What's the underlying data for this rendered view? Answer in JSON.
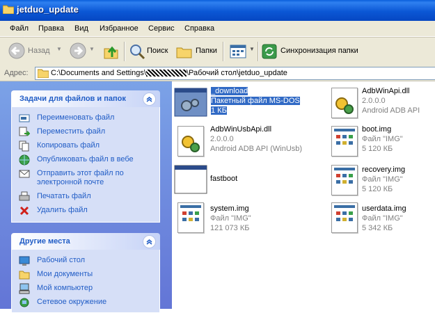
{
  "window": {
    "title": "jetduo_update"
  },
  "menu": [
    "Файл",
    "Правка",
    "Вид",
    "Избранное",
    "Сервис",
    "Справка"
  ],
  "toolbar": {
    "back": "Назад",
    "search": "Поиск",
    "folders": "Папки",
    "sync": "Синхронизация папки"
  },
  "address": {
    "label": "Адрес:",
    "path_start": "C:\\Documents and Settings\\",
    "path_end": "\\Рабочий стол\\jetduo_update"
  },
  "tasks_panel": {
    "title": "Задачи для файлов и папок",
    "items": [
      "Переименовать файл",
      "Переместить файл",
      "Копировать файл",
      "Опубликовать файл в вебе",
      "Отправить этот файл по электронной почте",
      "Печатать файл",
      "Удалить файл"
    ]
  },
  "places_panel": {
    "title": "Другие места",
    "items": [
      "Рабочий стол",
      "Мои документы",
      "Мой компьютер",
      "Сетевое окружение"
    ]
  },
  "files": [
    {
      "name": "_download",
      "type": "Пакетный файл MS-DOS",
      "size": "1 КБ",
      "icon": "batch-file-icon",
      "selected": true
    },
    {
      "name": "AdbWinApi.dll",
      "type": "2.0.0.0",
      "size": "Android ADB API",
      "icon": "dll-file-icon"
    },
    {
      "name": "AdbWinUsbApi.dll",
      "type": "2.0.0.0",
      "size": "Android ADB API (WinUsb)",
      "icon": "dll-file-icon"
    },
    {
      "name": "boot.img",
      "type": "Файл \"IMG\"",
      "size": "5 120 КБ",
      "icon": "img-file-icon"
    },
    {
      "name": "fastboot",
      "type": "",
      "size": "",
      "icon": "executable-file-icon"
    },
    {
      "name": "recovery.img",
      "type": "Файл \"IMG\"",
      "size": "5 120 КБ",
      "icon": "img-file-icon"
    },
    {
      "name": "system.img",
      "type": "Файл \"IMG\"",
      "size": "121 073 КБ",
      "icon": "img-file-icon"
    },
    {
      "name": "userdata.img",
      "type": "Файл \"IMG\"",
      "size": "5 342 КБ",
      "icon": "img-file-icon"
    }
  ],
  "colors": {
    "title_bar": "#0b57d5",
    "task_panel_bg": "#6f8cdc",
    "link": "#215dc6",
    "selection": "#316ac5"
  }
}
